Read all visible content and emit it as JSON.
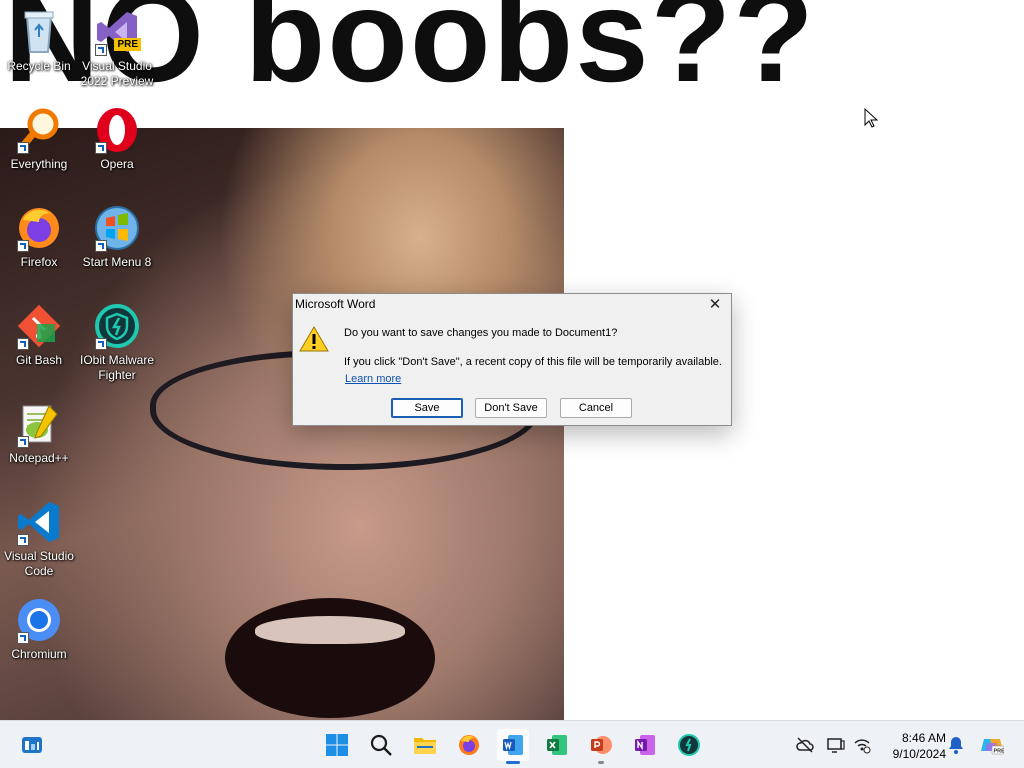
{
  "wallpaper": {
    "caption": "NO boobs??"
  },
  "desktop_icons": [
    {
      "label": "Recycle Bin",
      "icon": "recycle-bin-icon"
    },
    {
      "label": "Visual Studio 2022 Preview",
      "icon": "visual-studio-preview-icon",
      "badge": "PRE"
    },
    {
      "label": "Everything",
      "icon": "everything-search-icon"
    },
    {
      "label": "Opera",
      "icon": "opera-icon"
    },
    {
      "label": "Firefox",
      "icon": "firefox-icon"
    },
    {
      "label": "Start Menu 8",
      "icon": "start-menu-8-icon"
    },
    {
      "label": "Git Bash",
      "icon": "git-bash-icon"
    },
    {
      "label": "IObit Malware Fighter",
      "icon": "iobit-malware-fighter-icon"
    },
    {
      "label": "Notepad++",
      "icon": "notepad-plus-plus-icon"
    },
    {
      "label": "Visual Studio Code",
      "icon": "vscode-icon"
    },
    {
      "label": "Chromium",
      "icon": "chromium-icon"
    }
  ],
  "dialog": {
    "title": "Microsoft Word",
    "question": "Do you want to save changes you made to Document1?",
    "info": "If you click \"Don't Save\", a recent copy of this file will be temporarily available.",
    "learn_more": "Learn more",
    "buttons": {
      "save": "Save",
      "dont_save": "Don't Save",
      "cancel": "Cancel"
    },
    "close_glyph": "✕"
  },
  "taskbar": {
    "pinned": [
      {
        "name": "widgets-icon"
      },
      {
        "name": "start-icon"
      },
      {
        "name": "search-icon"
      },
      {
        "name": "file-explorer-icon"
      },
      {
        "name": "firefox-icon"
      },
      {
        "name": "word-icon",
        "state": "active"
      },
      {
        "name": "excel-icon"
      },
      {
        "name": "powerpoint-icon",
        "state": "running"
      },
      {
        "name": "onenote-icon"
      },
      {
        "name": "iobit-icon"
      }
    ],
    "tray": {
      "icons": [
        "onedrive-offline-icon",
        "display-icon",
        "network-icon",
        "notification-bell-icon",
        "copilot-icon"
      ],
      "time": "8:46 AM",
      "date": "9/10/2024"
    }
  },
  "colors": {
    "accent": "#1f6fd1",
    "dialog_bg": "#f0f0f0",
    "taskbar_bg": "#eef1f6"
  }
}
